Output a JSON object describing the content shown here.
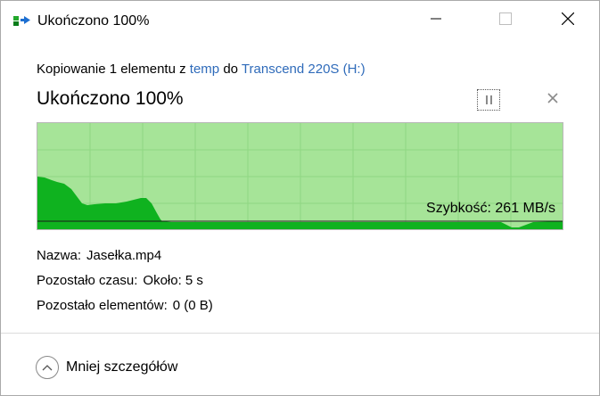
{
  "window": {
    "title": "Ukończono 100%"
  },
  "header": {
    "prefix": "Kopiowanie 1 elementu z",
    "source": "temp",
    "middle": "do",
    "destination": "Transcend 220S (H:)"
  },
  "status": {
    "title": "Ukończono 100%"
  },
  "graph": {
    "speed_label": "Szybkość: 261 MB/s",
    "fill_color": "#a6e498",
    "area_color": "#0fb21f",
    "grid_color": "#8fd682"
  },
  "details": {
    "name_label": "Nazwa:",
    "name_value": "Jasełka.mp4",
    "time_label": "Pozostało czasu:",
    "time_value": "Około: 5 s",
    "items_label": "Pozostało elementów:",
    "items_value": "0 (0 B)"
  },
  "footer": {
    "toggle_label": "Mniej szczegółów"
  },
  "icons": {
    "app": "copy-icon",
    "minimize": "minimize-icon",
    "maximize": "maximize-icon",
    "close": "close-icon",
    "pause": "pause-icon",
    "cancel": "cancel-icon",
    "collapse": "chevron-up-icon"
  }
}
